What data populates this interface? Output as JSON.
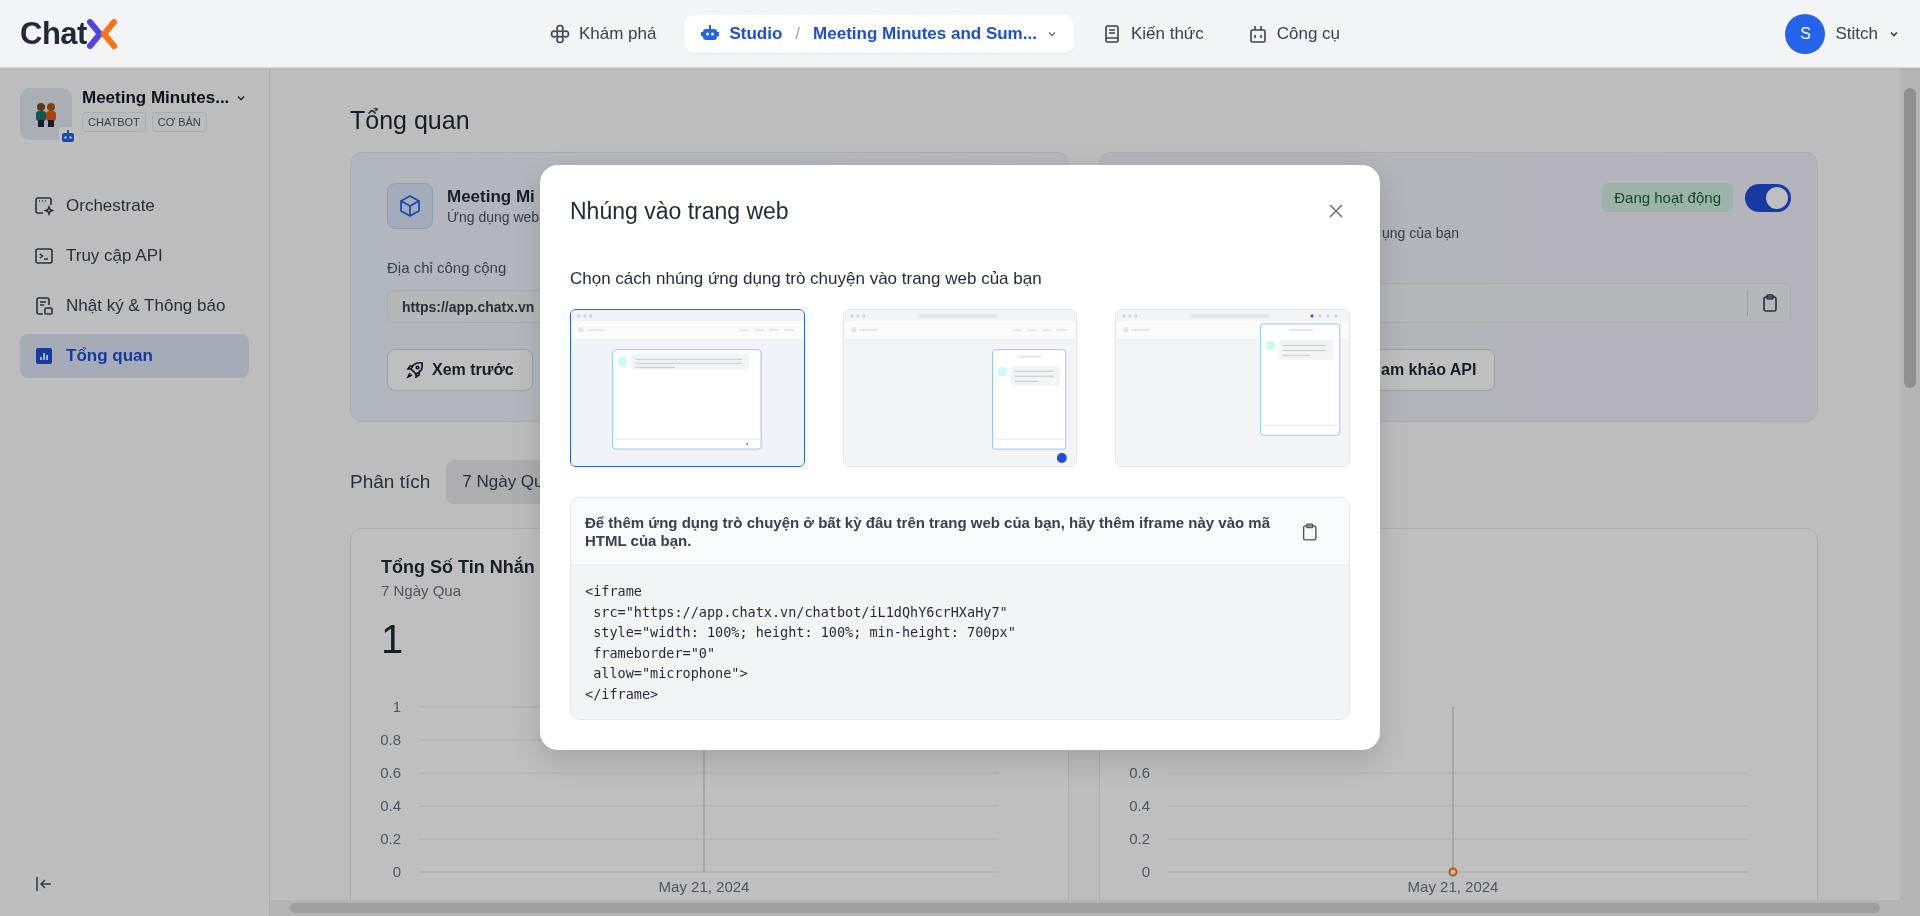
{
  "top_bar": {
    "logo": "Chat",
    "nav": [
      {
        "label": "Khám phá",
        "selected": false
      },
      {
        "label": "Studio",
        "selected": true,
        "separator": "/",
        "breadcrumb": "Meeting Minutes and Sum..."
      },
      {
        "label": "Kiến thức",
        "selected": false
      },
      {
        "label": "Công cụ",
        "selected": false
      }
    ],
    "user": {
      "initial": "S",
      "name": "Stitch"
    }
  },
  "sidebar": {
    "app": {
      "name": "Meeting Minutes...",
      "tags": [
        "CHATBOT",
        "CƠ BẢN"
      ]
    },
    "items": [
      {
        "label": "Orchestrate",
        "selected": false
      },
      {
        "label": "Truy cập API",
        "selected": false
      },
      {
        "label": "Nhật ký & Thông báo",
        "selected": false
      },
      {
        "label": "Tổng quan",
        "selected": true
      }
    ]
  },
  "overview": {
    "title": "Tổng quan",
    "app_card": {
      "name": "Meeting Mi",
      "description": "Ứng dụng web",
      "address_label": "Địa chỉ công cộng",
      "address": "https://app.chatx.vn",
      "buttons": [
        "Xem trước"
      ]
    },
    "api_card": {
      "description": "ụng của bạn",
      "status": "Đang hoạt động",
      "on": true,
      "buttons": [
        "am khảo API"
      ]
    }
  },
  "analytics": {
    "label": "Phân tích",
    "period": "7 Ngày Qu",
    "charts": [
      {
        "title": "Tổng Số Tin Nhắn",
        "subtitle": "7 Ngày Qua",
        "total": "1",
        "chart_data": {
          "type": "line",
          "categories": [
            "May 21, 2024"
          ],
          "ylim": [
            0,
            1
          ],
          "yticks": [
            0,
            0.2,
            0.4,
            0.6,
            0.8,
            1
          ],
          "grid": true,
          "ref_lines": [
            {
              "axis": "x",
              "value": "May 21, 2024"
            }
          ]
        }
      },
      {
        "chart_data": {
          "type": "line",
          "categories": [
            "May 21, 2024"
          ],
          "ylim": [
            0,
            1
          ],
          "yticks": [
            0,
            0.2,
            0.4,
            0.6
          ],
          "grid": true,
          "ref_lines": [
            {
              "axis": "x",
              "value": "May 21, 2024"
            }
          ],
          "series": [
            {
              "color": "#f97316",
              "values": [
                0
              ],
              "marker": "circle"
            }
          ]
        }
      }
    ]
  },
  "dialog": {
    "title": "Nhúng vào trang web",
    "subtitle": "Chọn cách nhúng ứng dụng trò chuyện vào trang web của bạn",
    "options": [
      {
        "kind": "fullscreen",
        "selected": true
      },
      {
        "kind": "bubble",
        "selected": false
      },
      {
        "kind": "extension",
        "selected": false
      }
    ],
    "instruction": "Để thêm ứng dụng trò chuyện ở bất kỳ đâu trên trang web của bạn, hãy thêm iframe này vào mã HTML của bạn.",
    "code": [
      "<iframe",
      " src=\"https://app.chatx.vn/chatbot/iL1dQhY6crHXaHy7\"",
      " style=\"width: 100%; height: 100%; min-height: 700px\"",
      " frameborder=\"0\"",
      " allow=\"microphone\">",
      "</iframe>"
    ]
  }
}
